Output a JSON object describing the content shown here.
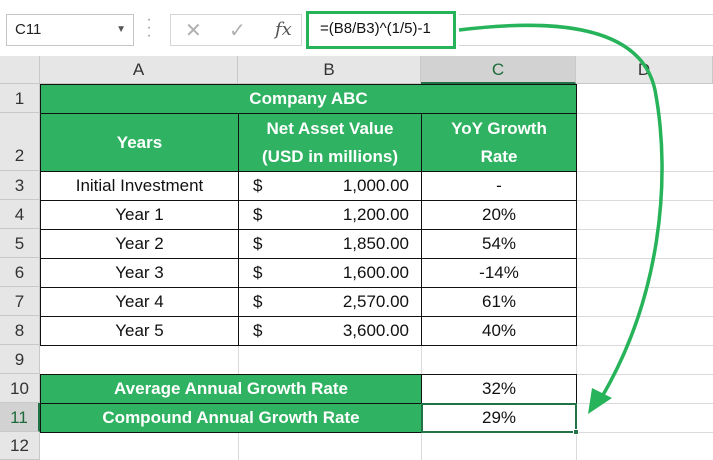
{
  "formula_bar": {
    "name_box": "C11",
    "cancel_icon": "✕",
    "enter_icon": "✓",
    "fx_label": "fx",
    "formula": "=(B8/B3)^(1/5)-1"
  },
  "columns": [
    "A",
    "B",
    "C",
    "D"
  ],
  "rows": [
    "1",
    "2",
    "3",
    "4",
    "5",
    "6",
    "7",
    "8",
    "9",
    "10",
    "11",
    "12"
  ],
  "table": {
    "title": "Company ABC",
    "headers": {
      "years": "Years",
      "nav_line1": "Net Asset Value",
      "nav_line2": "(USD in millions)",
      "yoy_line1": "YoY Growth",
      "yoy_line2": "Rate"
    },
    "data": [
      {
        "year": "Initial Investment",
        "currency": "$",
        "value": "1,000.00",
        "growth": "-"
      },
      {
        "year": "Year 1",
        "currency": "$",
        "value": "1,200.00",
        "growth": "20%"
      },
      {
        "year": "Year 2",
        "currency": "$",
        "value": "1,850.00",
        "growth": "54%"
      },
      {
        "year": "Year 3",
        "currency": "$",
        "value": "1,600.00",
        "growth": "-14%"
      },
      {
        "year": "Year 4",
        "currency": "$",
        "value": "2,570.00",
        "growth": "61%"
      },
      {
        "year": "Year 5",
        "currency": "$",
        "value": "3,600.00",
        "growth": "40%"
      }
    ],
    "summary": [
      {
        "label": "Average Annual Growth Rate",
        "value": "32%"
      },
      {
        "label": "Compound Annual Growth Rate",
        "value": "29%"
      }
    ]
  },
  "colors": {
    "accent_green": "#2fb261",
    "annotation_green": "#27b35a",
    "selection_green": "#217346"
  }
}
